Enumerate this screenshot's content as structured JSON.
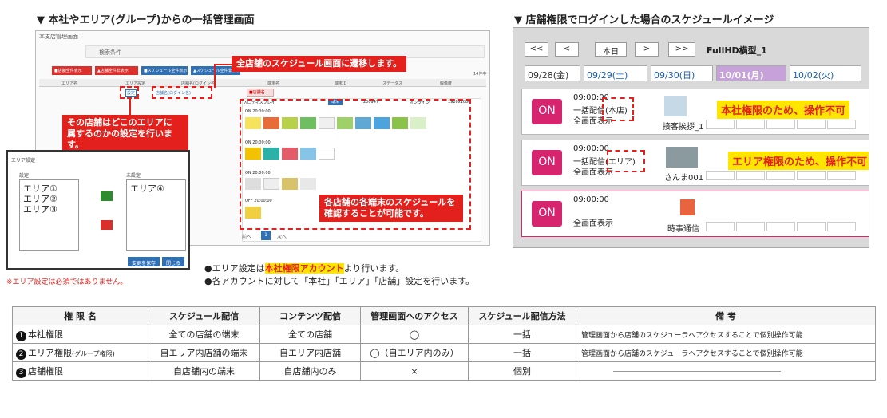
{
  "left_heading": "▼ 本社やエリア(グループ)からの一括管理画面",
  "right_heading": "▼ 店舗権限でログインした場合のスケジュールイメージ",
  "admin": {
    "title": "本支店管理画面",
    "search_label": "検索条件",
    "toolbar": [
      "■店舗全件表示",
      "▲店舗全件非表示",
      "■スケジュール全件表示",
      "▲スケジュール全件非表示"
    ],
    "count": "14件中",
    "columns": [
      "エリア名",
      "エリア設定",
      "店舗名(ログイン名)",
      "端末名",
      "端末ID",
      "ステータス",
      "解像度"
    ],
    "area_button": "設定",
    "store_link": "店舗名(ログイン名)",
    "row_tag": "■店舗名",
    "terminal": "入口ディスプレイ",
    "terminal_badge": "端末",
    "terminal_id": "200947",
    "status": "オンライン",
    "resolution": "1920x1080",
    "blocks": [
      "ON 20:00:00",
      "ON 20:00:00",
      "ON 20:00:00",
      "ON 20:00:00",
      "OFF 20:00:00"
    ],
    "pager": {
      "prev": "前へ",
      "page": "1",
      "next": "次へ"
    }
  },
  "popup": {
    "title": "エリア設定",
    "set_label": "設定",
    "unset_label": "未設定",
    "set_items": [
      "エリア①",
      "エリア②",
      "エリア③"
    ],
    "unset_items": [
      "エリア④"
    ],
    "move_right": ">>",
    "move_left": "<<",
    "save": "変更を保存",
    "close": "閉じる"
  },
  "callouts": {
    "transition": "全店舗のスケジュール画面に遷移します。",
    "area_setting": "その店舗はどこのエリアに\n属するのかの設定を行います。",
    "check_schedule": "各店舗の各端末のスケジュールを\n確認することが可能です。"
  },
  "schedule": {
    "nav": [
      "<<",
      "<",
      "本日",
      ">",
      ">>"
    ],
    "title": "FullHD横型_1",
    "dates": [
      "09/28(金)",
      "09/29(土)",
      "09/30(日)",
      "10/01(月)",
      "10/02(火)"
    ],
    "rows": [
      {
        "on": "ON",
        "time": "09:00:00",
        "line2": "一括配信(本店)",
        "line3": "全画面表示",
        "thumb_label": "接客挨拶_1",
        "notice": "本社権限のため、操作不可"
      },
      {
        "on": "ON",
        "time": "09:00:00",
        "line2": "一括配信(エリア)",
        "line3": "全画面表示",
        "thumb_label": "さんま001",
        "notice": "エリア権限のため、操作不可"
      },
      {
        "on": "ON",
        "time": "09:00:00",
        "line2": "",
        "line3": "全画面表示",
        "thumb_label": "時事通信",
        "notice": ""
      }
    ]
  },
  "notes": {
    "optional": "※エリア設定は必須ではありません。",
    "line1_pre": "●エリア設定は",
    "line1_hl": "本社権限アカウント",
    "line1_post": "より行います。",
    "line2": "●各アカウントに対して「本社」「エリア」「店舗」設定を行います。"
  },
  "table": {
    "headers": [
      "権 限 名",
      "スケジュール配信",
      "コンテンツ配信",
      "管理画面へのアクセス",
      "スケジュール配信方法",
      "備 考"
    ],
    "rows": [
      {
        "num": "1",
        "name": "本社権限",
        "sub": "",
        "schedule": "全ての店舗の端末",
        "content": "全ての店舗",
        "access": "◯",
        "method": "一括",
        "note": "管理画面から店舗のスケジューラへアクセスすることで個別操作可能"
      },
      {
        "num": "2",
        "name": "エリア権限",
        "sub": "(グループ権限)",
        "schedule": "自エリア内店舗の端末",
        "content": "自エリア内店舗",
        "access": "◯（自エリア内のみ）",
        "method": "一括",
        "note": "管理画面から店舗のスケジューラへアクセスすることで個別操作可能"
      },
      {
        "num": "3",
        "name": "店舗権限",
        "sub": "",
        "schedule": "自店舗内の端末",
        "content": "自店舗内のみ",
        "access": "×",
        "method": "個別",
        "note": ""
      }
    ]
  },
  "colors": {
    "accent_red": "#e3201b",
    "on_pink": "#d6246e",
    "highlight": "#ffe500"
  }
}
